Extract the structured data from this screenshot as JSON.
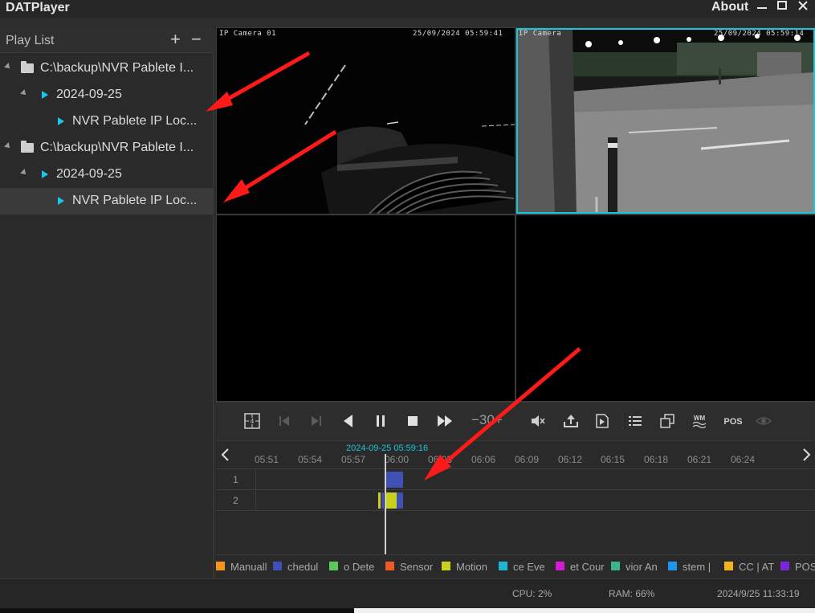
{
  "app": {
    "title": "DATPlayer",
    "about_label": "About"
  },
  "sidebar": {
    "title": "Play List",
    "add_label": "+",
    "remove_label": "−",
    "tree": [
      {
        "label": "C:\\backup\\NVR Pablete I...",
        "kind": "folder"
      },
      {
        "label": "2024-09-25",
        "kind": "date"
      },
      {
        "label": "NVR Pablete IP Loc...",
        "kind": "file"
      },
      {
        "label": "C:\\backup\\NVR Pablete I...",
        "kind": "folder"
      },
      {
        "label": "2024-09-25",
        "kind": "date"
      },
      {
        "label": "NVR Pablete IP Loc...",
        "kind": "file",
        "selected": true
      }
    ]
  },
  "video": {
    "cells": [
      {
        "camera": "IP Camera 01",
        "time": "25/09/2024 05:59:41"
      },
      {
        "camera": "IP Camera",
        "time": "25/09/2024 05:59:14"
      },
      {
        "camera": "",
        "time": ""
      },
      {
        "camera": "",
        "time": ""
      }
    ]
  },
  "toolbar": {
    "speed_label": "−30+",
    "buttons": [
      "split-screen-icon",
      "previous-frame-icon",
      "next-frame-icon",
      "play-backward-icon",
      "pause-icon",
      "stop-icon",
      "fast-forward-icon",
      "mute-icon",
      "export-icon",
      "clip-icon",
      "list-icon",
      "window-icon",
      "watermark-icon",
      "pos-icon",
      "eye-icon"
    ],
    "wm_label": "WM",
    "pos_label": "POS"
  },
  "timeline": {
    "cursor_time": "2024-09-25 05:59:16",
    "ticks": [
      "05:51",
      "05:54",
      "05:57",
      "06:00",
      "06:03",
      "06:06",
      "06:09",
      "06:12",
      "06:15",
      "06:18",
      "06:21",
      "06:24"
    ],
    "rows": [
      {
        "label": "1"
      },
      {
        "label": "2"
      }
    ]
  },
  "legend": [
    {
      "label": "Manuall",
      "color": "#f7941d"
    },
    {
      "label": "chedul",
      "color": "#3f51b5"
    },
    {
      "label": "o Dete",
      "color": "#5cc85c"
    },
    {
      "label": "Sensor",
      "color": "#f05a28"
    },
    {
      "label": "Motion",
      "color": "#c8d21e"
    },
    {
      "label": "ce Eve",
      "color": "#1eb4d2"
    },
    {
      "label": "et Cour",
      "color": "#d21ed2"
    },
    {
      "label": "vior An",
      "color": "#3cb48c"
    },
    {
      "label": "stem |",
      "color": "#1e96f0"
    },
    {
      "label": "CC | AT",
      "color": "#f0b41e"
    },
    {
      "label": "POS",
      "color": "#7828d2"
    }
  ],
  "status": {
    "cpu": "CPU: 2%",
    "ram": "RAM: 66%",
    "datetime": "2024/9/25 11:33:19"
  }
}
